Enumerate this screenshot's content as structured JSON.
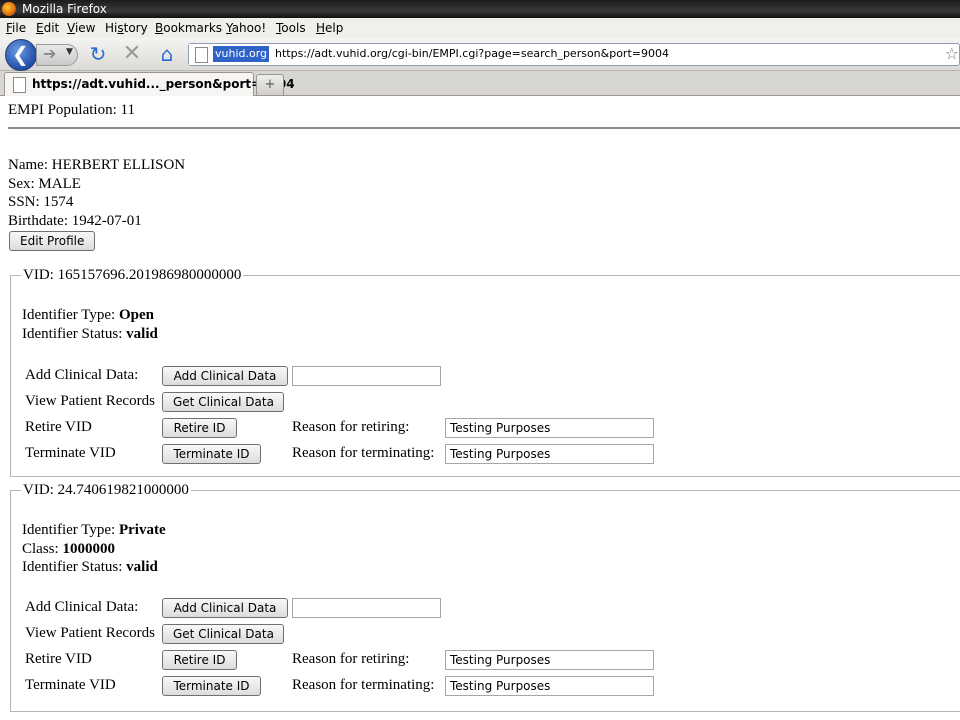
{
  "window": {
    "title": "Mozilla Firefox"
  },
  "menu": [
    {
      "key": "F",
      "rest": "ile"
    },
    {
      "key": "E",
      "rest": "dit"
    },
    {
      "key": "V",
      "rest": "iew"
    },
    {
      "pre": "Hi",
      "key": "s",
      "rest": "tory"
    },
    {
      "key": "B",
      "rest": "ookmarks"
    },
    {
      "key": "Y",
      "rest": "ahoo!"
    },
    {
      "key": "T",
      "rest": "ools"
    },
    {
      "key": "H",
      "rest": "elp"
    }
  ],
  "navbar": {
    "site_host": "vuhid.org",
    "url": "https://adt.vuhid.org/cgi-bin/EMPI.cgi?page=search_person&port=9004"
  },
  "tabs": {
    "active_label": "https://adt.vuhid..._person&port=9004",
    "new_tab_symbol": "+"
  },
  "page": {
    "population": "EMPI Population: 11",
    "person": {
      "name": "Name: HERBERT ELLISON",
      "sex": "Sex: MALE",
      "ssn": "SSN: 1574",
      "birthdate": "Birthdate: 1942-07-01"
    },
    "edit_profile_label": "Edit Profile",
    "vids": [
      {
        "legend": "VID: 165157696.201986980000000",
        "type_label": "Identifier Type: ",
        "type_value": "Open",
        "status_label": "Identifier Status: ",
        "status_value": "valid",
        "add_label": "Add Clinical Data:",
        "add_button": "Add Clinical Data",
        "add_value": "",
        "view_label": "View Patient Records",
        "view_button": "Get Clinical Data",
        "retire_label": "Retire VID",
        "retire_button": "Retire ID",
        "retire_reason_label": "Reason for retiring:",
        "retire_reason_value": "Testing Purposes",
        "terminate_label": "Terminate VID",
        "terminate_button": "Terminate ID",
        "terminate_reason_label": "Reason for terminating:",
        "terminate_reason_value": "Testing Purposes"
      },
      {
        "legend": "VID: 24.740619821000000",
        "type_label": "Identifier Type: ",
        "type_value": "Private",
        "class_label": "Class: ",
        "class_value": "1000000",
        "status_label": "Identifier Status: ",
        "status_value": "valid",
        "add_label": "Add Clinical Data:",
        "add_button": "Add Clinical Data",
        "add_value": "",
        "view_label": "View Patient Records",
        "view_button": "Get Clinical Data",
        "retire_label": "Retire VID",
        "retire_button": "Retire ID",
        "retire_reason_label": "Reason for retiring:",
        "retire_reason_value": "Testing Purposes",
        "terminate_label": "Terminate VID",
        "terminate_button": "Terminate ID",
        "terminate_reason_label": "Reason for terminating:",
        "terminate_reason_value": "Testing Purposes"
      }
    ]
  }
}
